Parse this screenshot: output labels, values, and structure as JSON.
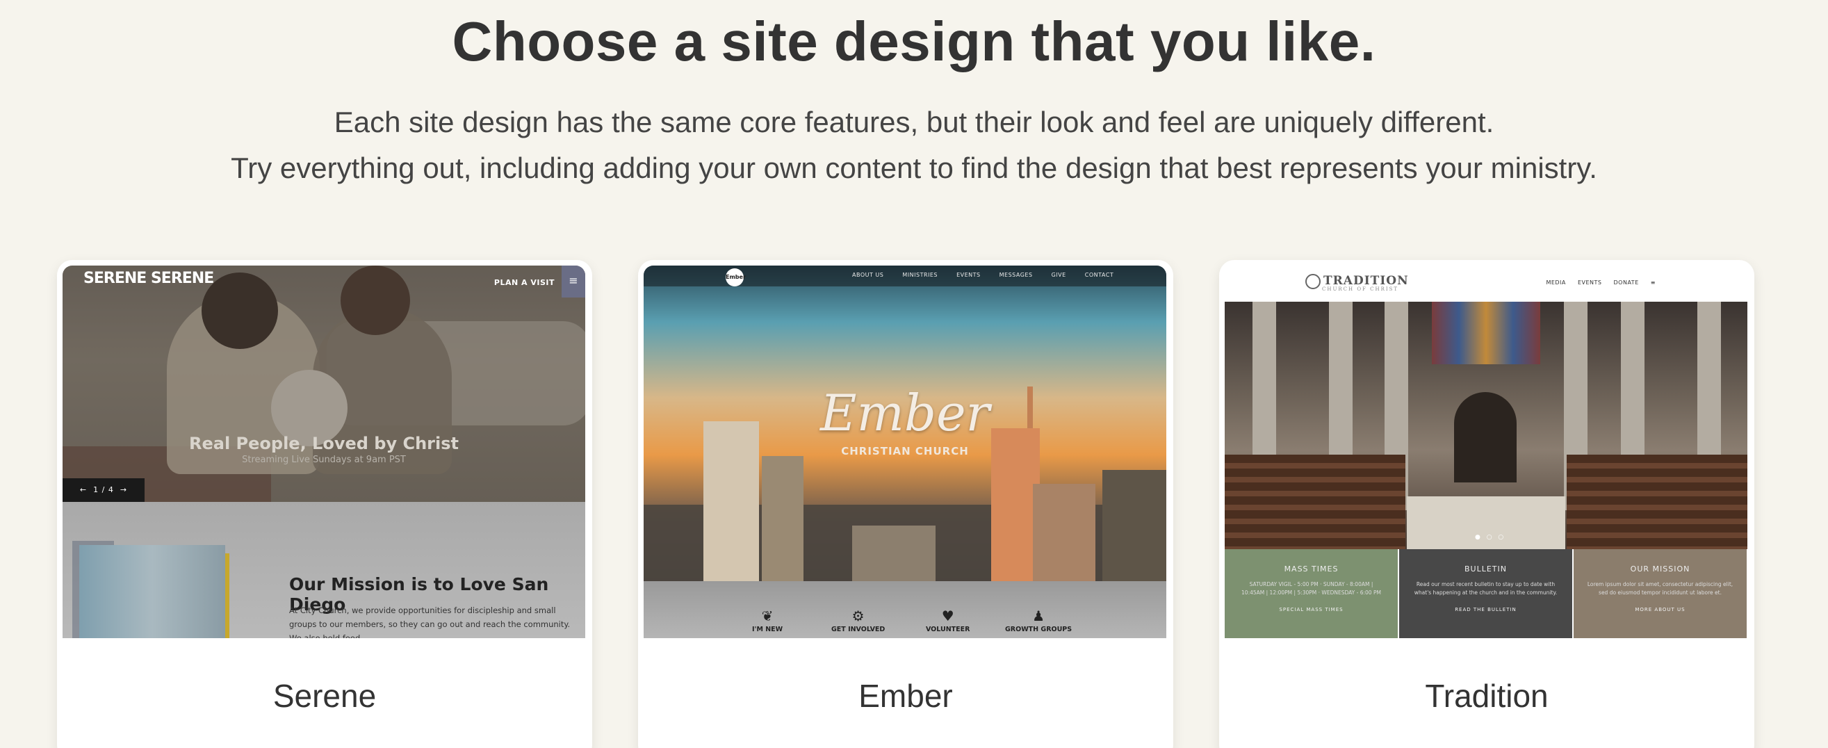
{
  "header": {
    "title": "Choose a site design that you like.",
    "subtitle_line1": "Each site design has the same core features, but their look and feel are uniquely different.",
    "subtitle_line2": "Try everything out, including adding your own content to find the design that best represents your ministry."
  },
  "colors": {
    "background": "#f6f4ed",
    "card": "#ffffff",
    "text": "#333333"
  },
  "cards": [
    {
      "name": "Serene",
      "preview": {
        "logo": "SERENE SERENE",
        "plan_visit": "PLAN A VISIT",
        "menu_icon": "menu-icon",
        "headline": "Real People, Loved by Christ",
        "subline": "Streaming Live Sundays at 9am PST",
        "slider_label": "1 / 4",
        "mission_title": "Our Mission is to Love San Diego",
        "mission_body": "At City Church, we provide opportunities for discipleship and small groups to our members, so they can go out and reach the community. We also hold food"
      }
    },
    {
      "name": "Ember",
      "preview": {
        "logo": "Ember",
        "nav": [
          "ABOUT US",
          "MINISTRIES",
          "EVENTS",
          "MESSAGES",
          "GIVE",
          "CONTACT"
        ],
        "title": "Ember",
        "subtitle": "CHRISTIAN CHURCH",
        "items": [
          "I'M NEW",
          "GET INVOLVED",
          "VOLUNTEER",
          "GROWTH GROUPS"
        ]
      }
    },
    {
      "name": "Tradition",
      "preview": {
        "logo": "TRADITION",
        "logo_sub": "CHURCH OF CHRIST",
        "nav": [
          "MEDIA",
          "EVENTS",
          "DONATE"
        ],
        "panels": [
          {
            "title": "MASS TIMES",
            "body": "SATURDAY VIGIL - 5:00 PM · SUNDAY - 8:00AM | 10:45AM | 12:00PM | 5:30PM · WEDNESDAY - 6:00 PM",
            "link": "SPECIAL MASS TIMES"
          },
          {
            "title": "BULLETIN",
            "body": "Read our most recent bulletin to stay up to date with what's happening at the church and in the community.",
            "link": "READ THE BULLETIN"
          },
          {
            "title": "OUR MISSION",
            "body": "Lorem ipsum dolor sit amet, consectetur adipiscing elit, sed do eiusmod tempor incididunt ut labore et.",
            "link": "MORE ABOUT US"
          }
        ]
      }
    }
  ]
}
